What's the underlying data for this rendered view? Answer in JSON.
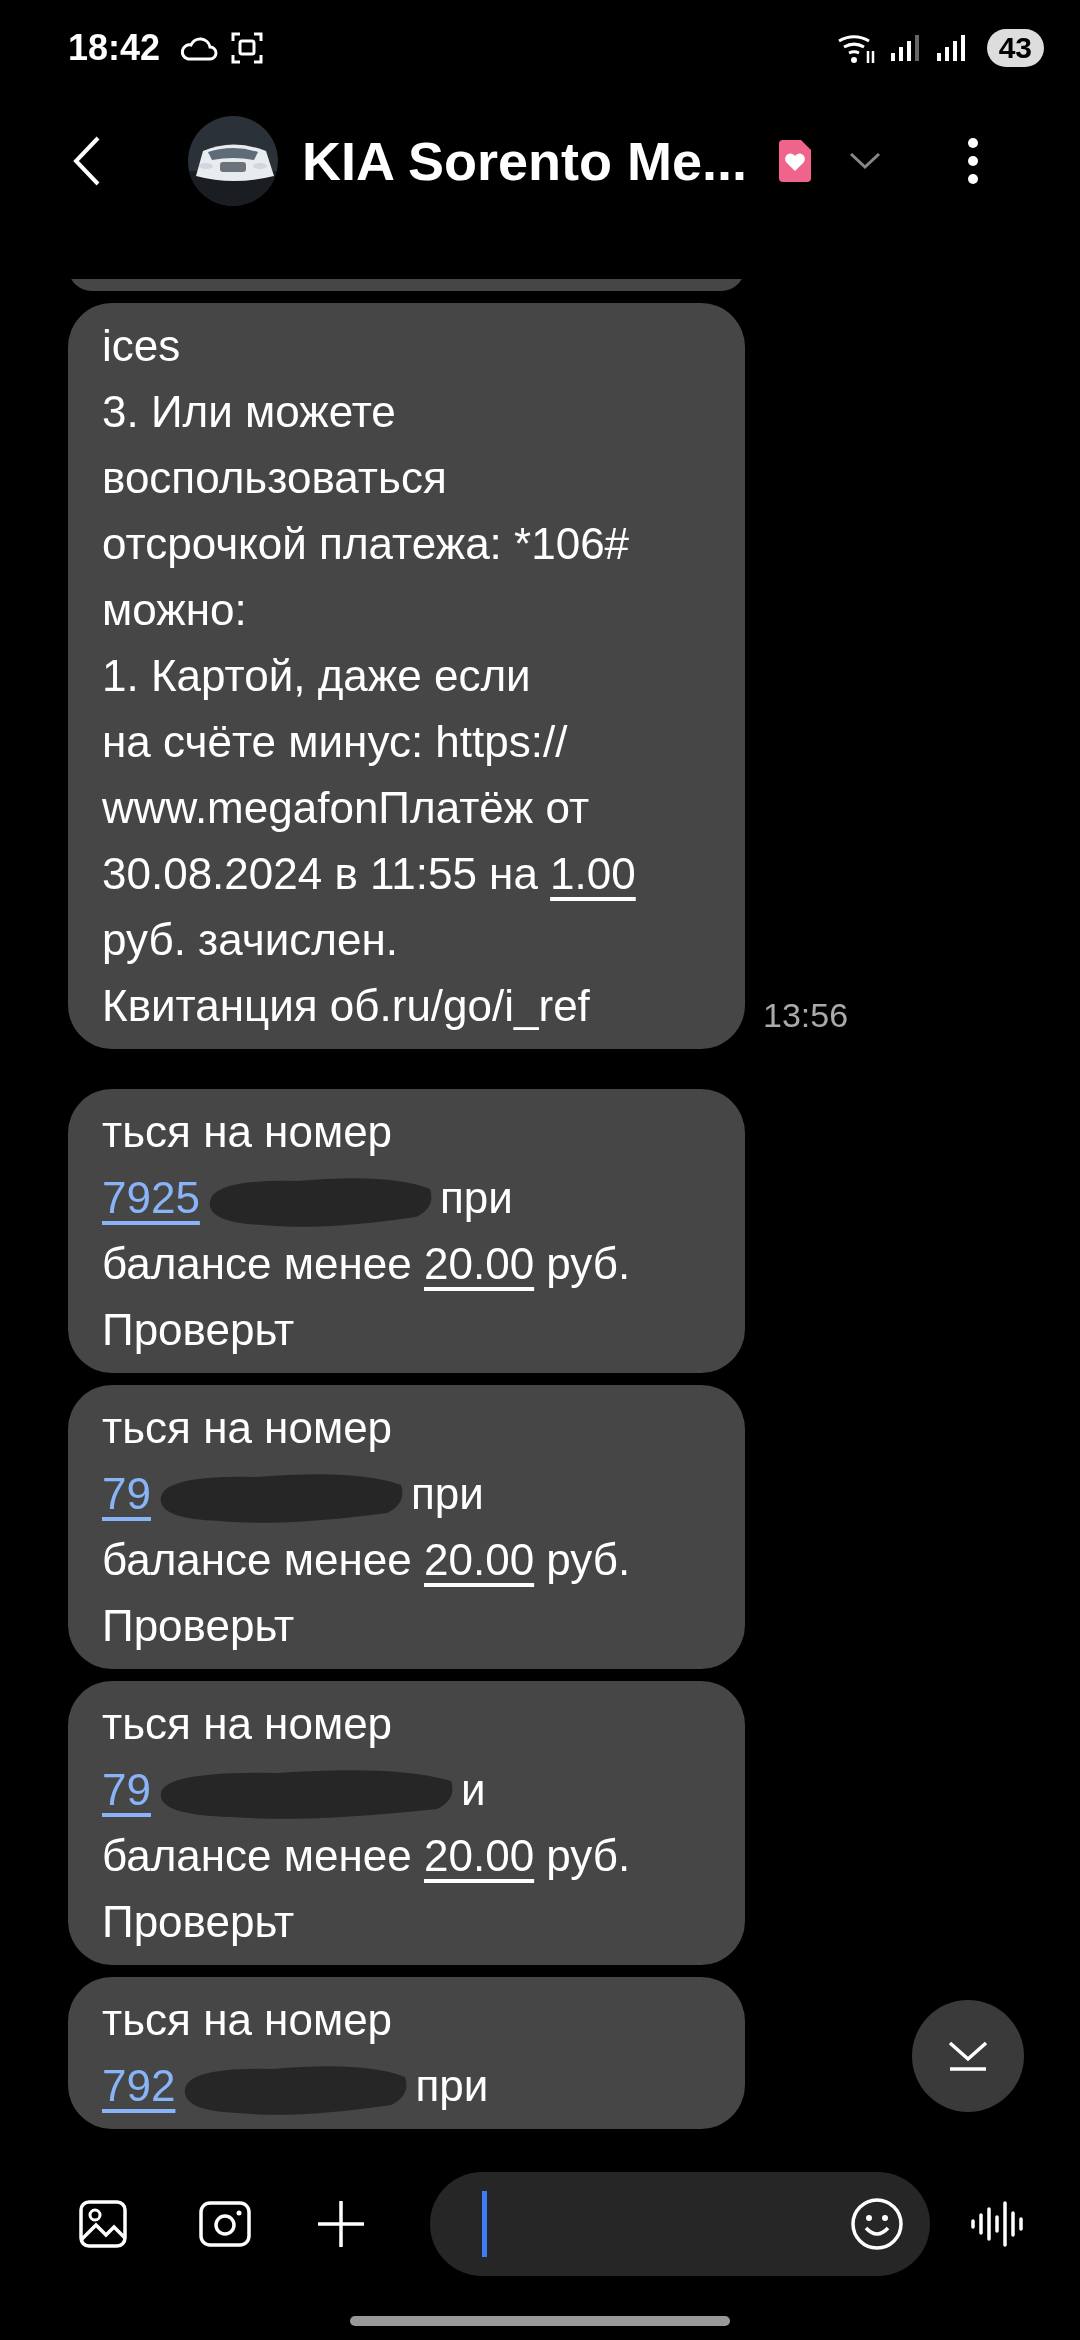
{
  "status_bar": {
    "time": "18:42",
    "battery": "43"
  },
  "header": {
    "title": "KIA Sorento Me..."
  },
  "messages": [
    {
      "time": "13:56",
      "lines": [
        [
          {
            "text": "ices",
            "kind": "plain"
          }
        ],
        [
          {
            "text": "3. Или можете",
            "kind": "plain"
          }
        ],
        [
          {
            "text": "воспользоваться",
            "kind": "plain"
          }
        ],
        [
          {
            "text": "отсрочкой платежа: *106#",
            "kind": "plain"
          }
        ],
        [
          {
            "text": "можно:",
            "kind": "plain"
          }
        ],
        [
          {
            "text": "1. Картой, даже если",
            "kind": "plain"
          }
        ],
        [
          {
            "text": "на счёте минус: https://",
            "kind": "plain"
          }
        ],
        [
          {
            "text": "www.megafonПлатёж от",
            "kind": "plain"
          }
        ],
        [
          {
            "text": "30.08.2024 в 11:55 на ",
            "kind": "plain"
          },
          {
            "text": "1.00",
            "kind": "amount"
          }
        ],
        [
          {
            "text": "руб. зачислен.",
            "kind": "plain"
          }
        ],
        [
          {
            "text": "Квитанция об.ru/go/i_ref",
            "kind": "plain"
          }
        ]
      ]
    },
    {
      "lines": [
        [
          {
            "text": "ться на номер",
            "kind": "plain"
          }
        ],
        [
          {
            "text": "7925",
            "kind": "phone"
          },
          {
            "kind": "redaction"
          },
          {
            "text": "при",
            "kind": "plain"
          }
        ],
        [
          {
            "text": "балансе менее ",
            "kind": "plain"
          },
          {
            "text": "20.00",
            "kind": "amount"
          },
          {
            "text": " руб.",
            "kind": "plain"
          }
        ],
        [
          {
            "text": "Проверьт",
            "kind": "plain"
          }
        ]
      ]
    },
    {
      "lines": [
        [
          {
            "text": "ться на номер",
            "kind": "plain"
          }
        ],
        [
          {
            "text": "79",
            "kind": "phone"
          },
          {
            "kind": "redaction"
          },
          {
            "text": "при",
            "kind": "plain"
          }
        ],
        [
          {
            "text": "балансе менее ",
            "kind": "plain"
          },
          {
            "text": "20.00",
            "kind": "amount"
          },
          {
            "text": " руб.",
            "kind": "plain"
          }
        ],
        [
          {
            "text": "Проверьт",
            "kind": "plain"
          }
        ]
      ]
    },
    {
      "lines": [
        [
          {
            "text": "ться на номер",
            "kind": "plain"
          }
        ],
        [
          {
            "text": "79",
            "kind": "phone"
          },
          {
            "kind": "redaction"
          },
          {
            "text": "и",
            "kind": "plain"
          }
        ],
        [
          {
            "text": "балансе менее ",
            "kind": "plain"
          },
          {
            "text": "20.00",
            "kind": "amount"
          },
          {
            "text": " руб.",
            "kind": "plain"
          }
        ],
        [
          {
            "text": "Проверьт",
            "kind": "plain"
          }
        ]
      ]
    },
    {
      "lines": [
        [
          {
            "text": "ться на номер",
            "kind": "plain"
          }
        ],
        [
          {
            "text": "792",
            "kind": "phone"
          },
          {
            "kind": "redaction"
          },
          {
            "text": "при",
            "kind": "plain"
          }
        ]
      ]
    }
  ]
}
